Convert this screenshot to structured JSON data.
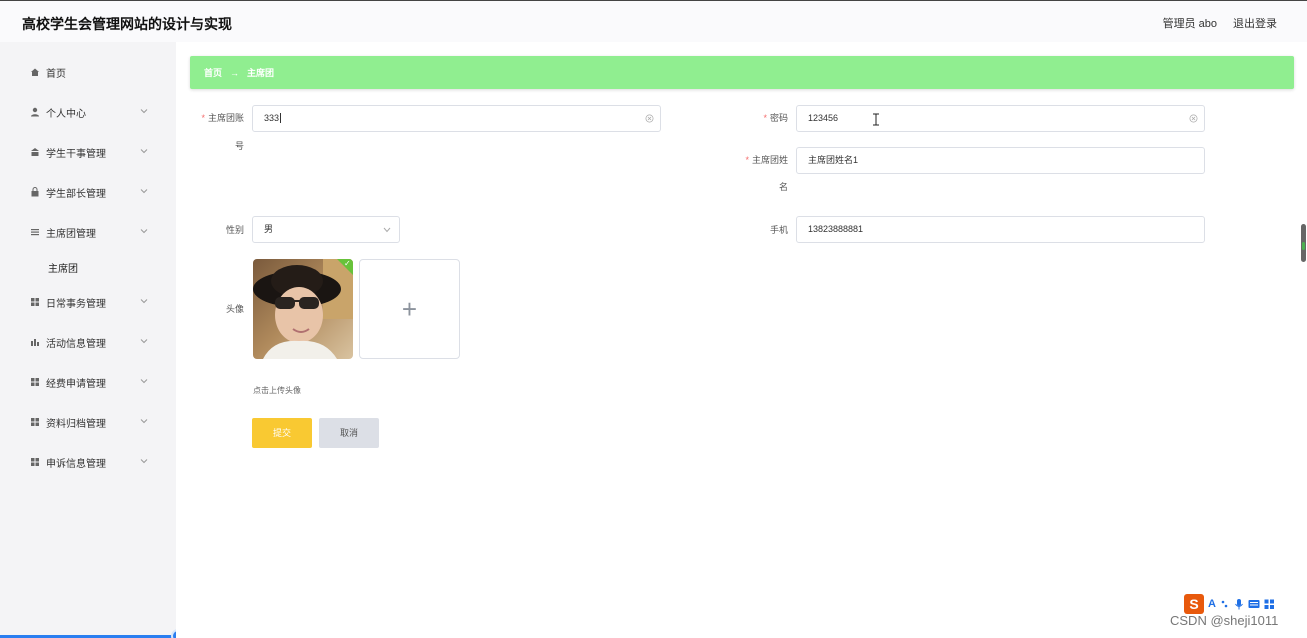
{
  "app": {
    "title": "高校学生会管理网站的设计与实现"
  },
  "header": {
    "user_label": "管理员 abo",
    "logout_label": "退出登录"
  },
  "sidebar": {
    "items": [
      {
        "label": "首页",
        "icon": "home-icon"
      },
      {
        "label": "个人中心",
        "icon": "user-icon"
      },
      {
        "label": "学生干事管理",
        "icon": "staff-icon"
      },
      {
        "label": "学生部长管理",
        "icon": "lock-icon"
      },
      {
        "label": "主席团管理",
        "icon": "menu-icon"
      },
      {
        "label": "日常事务管理",
        "icon": "grid-icon"
      },
      {
        "label": "活动信息管理",
        "icon": "chart-icon"
      },
      {
        "label": "经费申请管理",
        "icon": "grid-icon"
      },
      {
        "label": "资料归档管理",
        "icon": "grid-icon"
      },
      {
        "label": "申诉信息管理",
        "icon": "grid-icon"
      }
    ],
    "submenu": {
      "label": "主席团"
    }
  },
  "breadcrumb": {
    "home": "首页",
    "separator": "→",
    "current": "主席团"
  },
  "form": {
    "account": {
      "label_line1": "主席团账",
      "label_line2": "号",
      "value": "333"
    },
    "password": {
      "label": "密码",
      "value": "123456"
    },
    "name": {
      "label_line1": "主席团姓",
      "label_line2": "名",
      "value": "主席团姓名1"
    },
    "gender": {
      "label": "性别",
      "value": "男"
    },
    "phone": {
      "label": "手机",
      "value": "13823888881"
    },
    "avatar": {
      "label": "头像",
      "upload_tip": "点击上传头像",
      "plus": "+"
    },
    "submit_label": "提交",
    "cancel_label": "取消"
  },
  "ime": {
    "logo": "S",
    "mode": "A"
  },
  "watermark": "CSDN @sheji1011",
  "colors": {
    "breadcrumb_bg": "#90ee90",
    "submit_bg": "#f9c932",
    "required": "#f56c6c"
  }
}
